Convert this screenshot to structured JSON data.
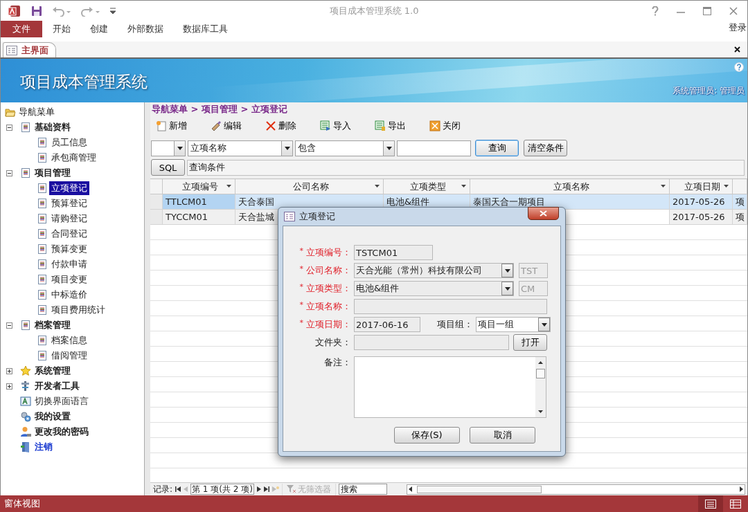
{
  "title_bar": {
    "title": "项目成本管理系统 1.0"
  },
  "ribbon": {
    "tabs": [
      {
        "label": "文件",
        "selected": true
      },
      {
        "label": "开始",
        "selected": false
      },
      {
        "label": "创建",
        "selected": false
      },
      {
        "label": "外部数据",
        "selected": false
      },
      {
        "label": "数据库工具",
        "selected": false
      }
    ],
    "login": "登录"
  },
  "document_tabs": [
    {
      "label": "主界面",
      "selected": true
    }
  ],
  "banner": {
    "title": "项目成本管理系统",
    "user": "系统管理员: 管理员"
  },
  "navigation": {
    "root": "导航菜单",
    "items": [
      {
        "label": "基础资料",
        "kind": "page",
        "bold": true,
        "expanded": true,
        "selected": false,
        "children": [
          {
            "label": "员工信息",
            "kind": "page",
            "bold": false,
            "selected": false
          },
          {
            "label": "承包商管理",
            "kind": "page",
            "bold": false,
            "selected": false
          }
        ]
      },
      {
        "label": "项目管理",
        "kind": "page",
        "bold": true,
        "expanded": true,
        "selected": false,
        "children": [
          {
            "label": "立项登记",
            "kind": "page",
            "bold": false,
            "selected": true
          },
          {
            "label": "预算登记",
            "kind": "page",
            "bold": false,
            "selected": false
          },
          {
            "label": "请购登记",
            "kind": "page",
            "bold": false,
            "selected": false
          },
          {
            "label": "合同登记",
            "kind": "page",
            "bold": false,
            "selected": false
          },
          {
            "label": "预算变更",
            "kind": "page",
            "bold": false,
            "selected": false
          },
          {
            "label": "付款申请",
            "kind": "page",
            "bold": false,
            "selected": false
          },
          {
            "label": "项目变更",
            "kind": "page",
            "bold": false,
            "selected": false
          },
          {
            "label": "中标造价",
            "kind": "page",
            "bold": false,
            "selected": false
          },
          {
            "label": "项目费用统计",
            "kind": "page",
            "bold": false,
            "selected": false
          }
        ]
      },
      {
        "label": "档案管理",
        "kind": "page",
        "bold": true,
        "expanded": true,
        "selected": false,
        "children": [
          {
            "label": "档案信息",
            "kind": "page",
            "bold": false,
            "selected": false
          },
          {
            "label": "借阅管理",
            "kind": "page",
            "bold": false,
            "selected": false
          }
        ]
      },
      {
        "label": "系统管理",
        "kind": "star",
        "bold": true,
        "expanded": false,
        "selected": false
      },
      {
        "label": "开发者工具",
        "kind": "tools",
        "bold": true,
        "expanded": false,
        "selected": false
      },
      {
        "label": "切换界面语言",
        "kind": "language",
        "bold": false,
        "selected": false
      },
      {
        "label": "我的设置",
        "kind": "settings",
        "bold": true,
        "selected": false
      },
      {
        "label": "更改我的密码",
        "kind": "password",
        "bold": true,
        "selected": false
      },
      {
        "label": "注销",
        "kind": "logout",
        "bold": true,
        "selected": false
      }
    ]
  },
  "breadcrumb": "导航菜单 > 项目管理 > 立项登记",
  "toolbar": [
    {
      "label": "新增",
      "kind": "new"
    },
    {
      "label": "编辑",
      "kind": "edit"
    },
    {
      "label": "删除",
      "kind": "delete"
    },
    {
      "label": "导入",
      "kind": "import"
    },
    {
      "label": "导出",
      "kind": "export"
    },
    {
      "label": "关闭",
      "kind": "close"
    }
  ],
  "filter": {
    "column": "立项名称",
    "operator": "包含",
    "query_button": "查询",
    "clear_button": "清空条件",
    "sql_button": "SQL",
    "condition": "查询条件"
  },
  "table": {
    "columns": [
      "立项编号",
      "公司名称",
      "立项类型",
      "立项名称",
      "立项日期"
    ],
    "rows": [
      {
        "selected": true,
        "code": "TTLCM01",
        "company": "天合泰国",
        "type": "电池&组件",
        "name": "泰国天合一期项目",
        "date": "2017-05-26",
        "column_6": "项"
      },
      {
        "selected": false,
        "code": "TYCCM01",
        "company": "天合盐城",
        "date": "2017-05-26",
        "column_6": "项"
      }
    ]
  },
  "record_navigator": {
    "label": "记录:",
    "position": "第 1 项(共 2 项)",
    "filter": "无筛选器",
    "search": "搜索"
  },
  "dialog": {
    "title": "立项登记",
    "fields": [
      {
        "kind": "text",
        "mark": "*",
        "required": true,
        "label": "立项编号：",
        "value": "TSTCM01"
      },
      {
        "kind": "combo",
        "mark": "*",
        "required": true,
        "label": "公司名称：",
        "value": "天合光能（常州）科技有限公司",
        "code": "TST"
      },
      {
        "kind": "combo",
        "mark": "*",
        "required": true,
        "label": "立项类型：",
        "value": "电池&组件",
        "code": "CM"
      },
      {
        "kind": "wide",
        "mark": "*",
        "required": true,
        "label": "立项名称："
      },
      {
        "kind": "date",
        "mark": "*",
        "required": true,
        "label": "立项日期：",
        "value": "2017-06-16",
        "group_label": "项目组：",
        "group_value": "项目一组"
      },
      {
        "kind": "folder",
        "required": false,
        "label": "文件夹：",
        "button": "打开"
      },
      {
        "kind": "memo",
        "required": false,
        "label": "备注："
      }
    ],
    "buttons": [
      "保存(S)",
      "取消"
    ]
  },
  "status_bar": {
    "text": "窗体视图",
    "views": [
      {
        "kind": "form",
        "selected": true
      },
      {
        "kind": "datasheet",
        "selected": false
      }
    ]
  }
}
